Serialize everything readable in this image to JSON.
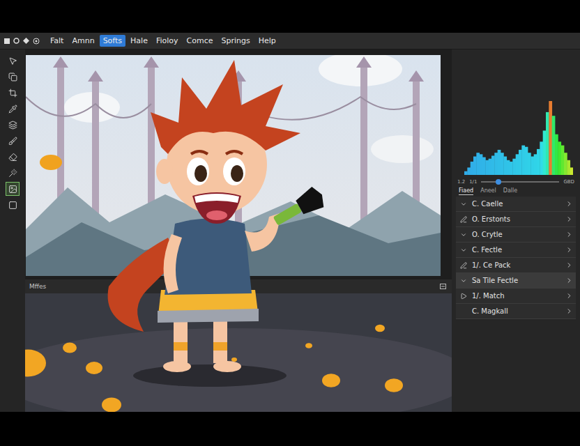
{
  "menu": [
    {
      "label": "Falt",
      "selected": false
    },
    {
      "label": "Amnn",
      "selected": false
    },
    {
      "label": "Softs",
      "selected": true
    },
    {
      "label": "Hale",
      "selected": false
    },
    {
      "label": "Fioloy",
      "selected": false
    },
    {
      "label": "Comce",
      "selected": false
    },
    {
      "label": "Springs",
      "selected": false
    },
    {
      "label": "Help",
      "selected": false
    }
  ],
  "tools": [
    {
      "selected": false
    },
    {
      "selected": false
    },
    {
      "selected": false
    },
    {
      "selected": false
    },
    {
      "selected": false
    },
    {
      "selected": false
    },
    {
      "selected": false
    },
    {
      "selected": false
    },
    {
      "selected": true
    },
    {
      "selected": false
    }
  ],
  "strip": {
    "label": "Mffes"
  },
  "histogram": {
    "values": [
      5,
      10,
      18,
      25,
      30,
      28,
      24,
      20,
      22,
      26,
      30,
      34,
      30,
      25,
      20,
      18,
      22,
      28,
      34,
      40,
      38,
      30,
      25,
      28,
      35,
      45,
      60,
      85,
      100,
      80,
      55,
      45,
      40,
      30,
      20,
      10
    ],
    "ticks": [
      "1.2",
      "1/1",
      "GBD"
    ],
    "level": 0.22
  },
  "panel_tabs": [
    {
      "label": "Fiaed",
      "selected": true
    },
    {
      "label": "Aneel",
      "selected": false
    },
    {
      "label": "Dalle",
      "selected": false
    }
  ],
  "layers": [
    {
      "label": "C. Caelle",
      "kind": "check",
      "selected": false
    },
    {
      "label": "O. Erstonts",
      "kind": "edit",
      "selected": false
    },
    {
      "label": "O. Crytle",
      "kind": "check",
      "selected": false
    },
    {
      "label": "C. Fectle",
      "kind": "check",
      "selected": false
    },
    {
      "label": "1/. Ce Pack",
      "kind": "edit",
      "selected": false
    },
    {
      "label": "Sa Tile Fectle",
      "kind": "check",
      "selected": true
    },
    {
      "label": "1/. Match",
      "kind": "play",
      "selected": false
    },
    {
      "label": "C. Magkall",
      "kind": "none",
      "selected": false
    }
  ]
}
